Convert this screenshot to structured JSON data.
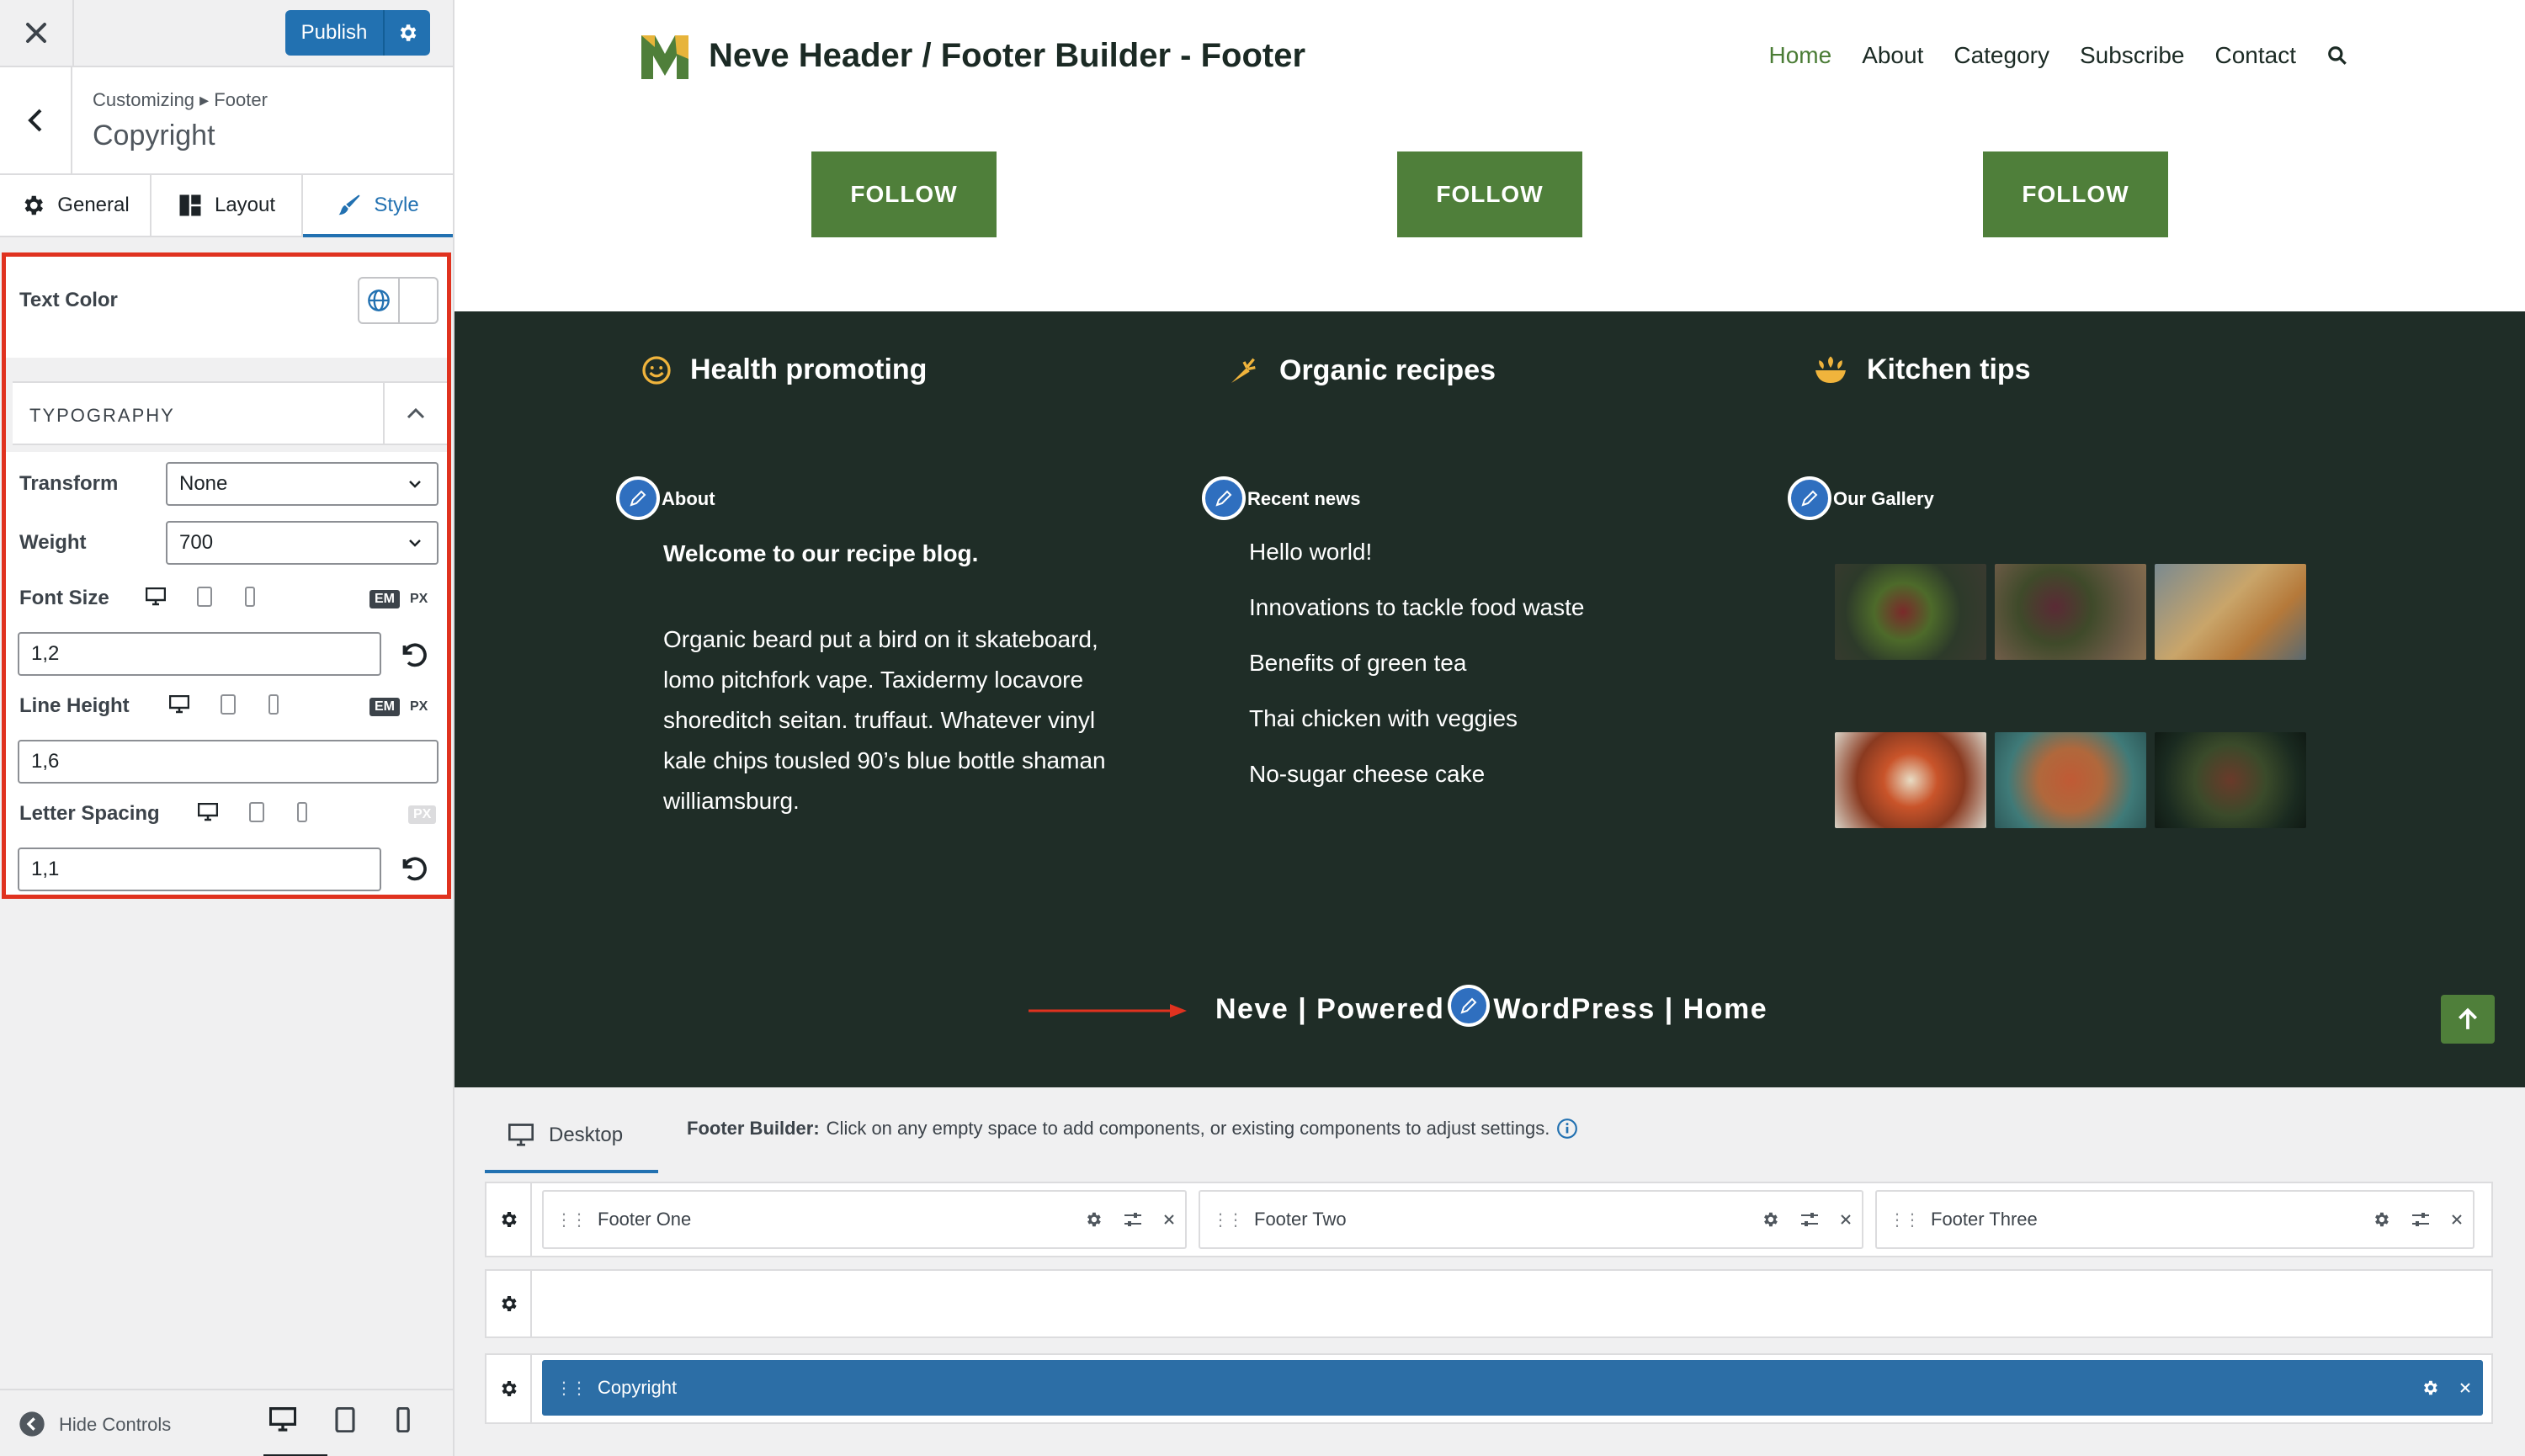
{
  "customizer": {
    "publish_label": "Publish",
    "breadcrumb": "Customizing ▸ Footer",
    "section_title": "Copyright",
    "tabs": [
      {
        "label": "General",
        "icon": "gear-icon"
      },
      {
        "label": "Layout",
        "icon": "layout-icon"
      },
      {
        "label": "Style",
        "icon": "brush-icon"
      }
    ],
    "text_color_label": "Text Color",
    "typography_title": "TYPOGRAPHY",
    "transform_label": "Transform",
    "transform_value": "None",
    "weight_label": "Weight",
    "weight_value": "700",
    "font_size_label": "Font Size",
    "font_size_value": "1,2",
    "line_height_label": "Line Height",
    "line_height_value": "1,6",
    "letter_spacing_label": "Letter Spacing",
    "letter_spacing_value": "1,1",
    "unit_em": "EM",
    "unit_px": "PX",
    "hide_controls_label": "Hide Controls"
  },
  "site": {
    "title": "Neve Header / Footer Builder - Footer",
    "nav": [
      "Home",
      "About",
      "Category",
      "Subscribe",
      "Contact"
    ],
    "follow_label": "FOLLOW",
    "features": [
      "Health promoting",
      "Organic recipes",
      "Kitchen tips"
    ],
    "about": {
      "title": "About",
      "lead": "Welcome to our recipe blog.",
      "lines": [
        "Organic beard put a bird on it skateboard,",
        "lomo pitchfork vape. Taxidermy locavore",
        "shoreditch seitan. truffaut. Whatever vinyl",
        "kale chips tousled 90’s blue bottle shaman",
        "williamsburg."
      ]
    },
    "news": {
      "title": "Recent news",
      "items": [
        "Hello world!",
        "Innovations to tackle food waste",
        "Benefits of green tea",
        "Thai chicken with veggies",
        "No-sugar cheese cake"
      ]
    },
    "gallery_title": "Our Gallery",
    "copyright": {
      "part1": "Neve | Powered",
      "part2": "WordPress | Home"
    },
    "colors": {
      "green": "#4f7f3a",
      "dark": "#1f2d27",
      "accent_blue": "#2271b1"
    }
  },
  "builder": {
    "tab_label": "Desktop",
    "info_bold": "Footer Builder:",
    "info_text": "Click on any empty space to add components, or existing components to adjust settings.",
    "components": [
      "Footer One",
      "Footer Two",
      "Footer Three"
    ],
    "copyright_component": "Copyright"
  }
}
